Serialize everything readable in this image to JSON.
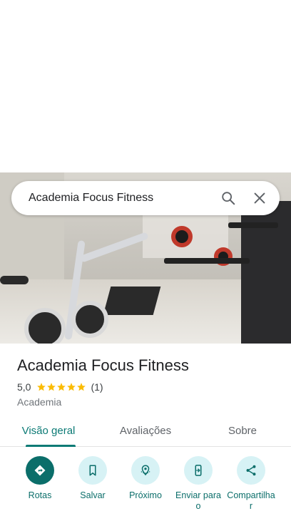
{
  "search": {
    "query": "Academia Focus Fitness"
  },
  "place": {
    "name": "Academia Focus Fitness",
    "rating": "5,0",
    "stars": 5,
    "review_count": "(1)",
    "category": "Academia"
  },
  "tabs": [
    {
      "label": "Visão geral",
      "active": true
    },
    {
      "label": "Avaliações",
      "active": false
    },
    {
      "label": "Sobre",
      "active": false
    }
  ],
  "actions": [
    {
      "label": "Rotas",
      "icon": "directions-icon"
    },
    {
      "label": "Salvar",
      "icon": "bookmark-icon"
    },
    {
      "label": "Próximo",
      "icon": "nearby-icon"
    },
    {
      "label": "Enviar para o",
      "icon": "send-to-phone-icon"
    },
    {
      "label": "Compartilhar",
      "icon": "share-icon"
    }
  ],
  "colors": {
    "accent": "#0b6e6a",
    "star": "#fbbc04",
    "action_bg": "#d7f2f5"
  }
}
